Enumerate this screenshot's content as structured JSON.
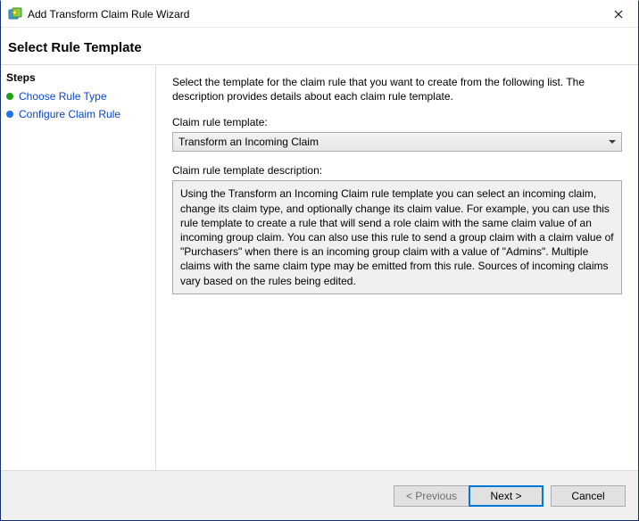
{
  "window": {
    "title": "Add Transform Claim Rule Wizard"
  },
  "header": {
    "title": "Select Rule Template"
  },
  "sidebar": {
    "heading": "Steps",
    "items": [
      {
        "label": "Choose Rule Type",
        "bulletColor": "#20a020"
      },
      {
        "label": "Configure Claim Rule",
        "bulletColor": "#1e73e8"
      }
    ]
  },
  "content": {
    "instructions": "Select the template for the claim rule that you want to create from the following list. The description provides details about each claim rule template.",
    "dropdown_label": "Claim rule template:",
    "dropdown_value": "Transform an Incoming Claim",
    "description_label": "Claim rule template description:",
    "description_text": "Using the Transform an Incoming Claim rule template you can select an incoming claim, change its claim type, and optionally change its claim value.  For example, you can use this rule template to create a rule that will send a role claim with the same claim value of an incoming group claim.  You can also use this rule to send a group claim with a claim value of \"Purchasers\" when there is an incoming group claim with a value of \"Admins\".  Multiple claims with the same claim type may be emitted from this rule.  Sources of incoming claims vary based on the rules being edited."
  },
  "footer": {
    "previous": "< Previous",
    "next": "Next >",
    "cancel": "Cancel"
  }
}
